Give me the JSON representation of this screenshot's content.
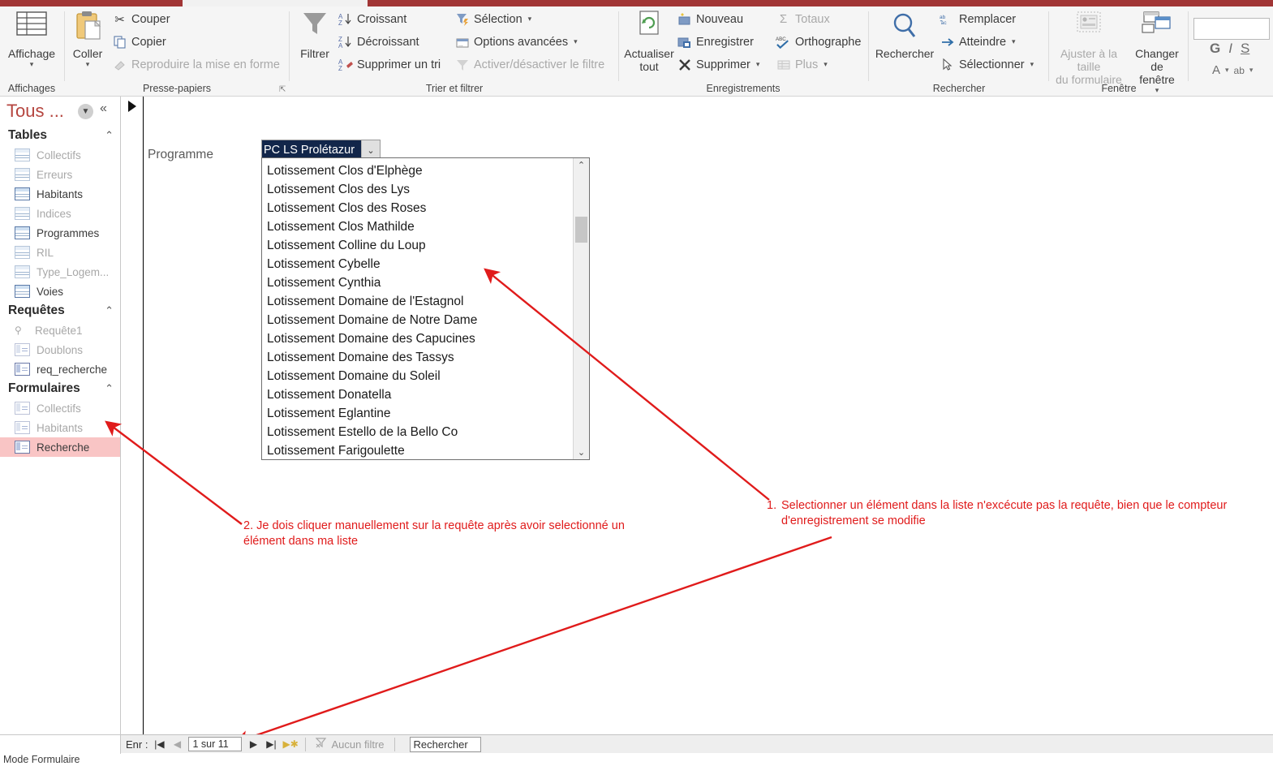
{
  "ribbon": {
    "groups": [
      {
        "name": "Affichages",
        "title": "Affichages"
      },
      {
        "name": "Presse-papiers",
        "title": "Presse-papiers"
      },
      {
        "name": "Trier et filtrer",
        "title": "Trier et filtrer"
      },
      {
        "name": "Enregistrements",
        "title": "Enregistrements"
      },
      {
        "name": "Rechercher",
        "title": "Rechercher"
      },
      {
        "name": "Fenetre",
        "title": "Fenêtre"
      }
    ],
    "affichages": {
      "big_label": "Affichage",
      "icon": "datasheet-view-icon",
      "group_title": "Affichages"
    },
    "presse_papiers": {
      "big_label": "Coller",
      "icon": "clipboard-icon",
      "items": [
        {
          "label": "Couper",
          "icon": "scissors-icon",
          "disabled": false
        },
        {
          "label": "Copier",
          "icon": "copy-icon",
          "disabled": false
        },
        {
          "label": "Reproduire la mise en forme",
          "icon": "format-painter-icon",
          "disabled": true
        }
      ],
      "group_title": "Presse-papiers"
    },
    "trier_filtrer": {
      "big_label": "Filtrer",
      "icon": "funnel-icon",
      "items": [
        {
          "label": "Croissant",
          "icon": "sort-ascending-icon",
          "disabled": false
        },
        {
          "label": "Décroissant",
          "icon": "sort-descending-icon",
          "disabled": false
        },
        {
          "label": "Supprimer un tri",
          "icon": "clear-sort-icon",
          "disabled": false
        },
        {
          "label": "Sélection",
          "icon": "selection-filter-icon",
          "disabled": false,
          "has_dropdown": true
        },
        {
          "label": "Options avancées",
          "icon": "advanced-filter-icon",
          "disabled": false,
          "has_dropdown": true
        },
        {
          "label": "Activer/désactiver le filtre",
          "icon": "toggle-filter-icon",
          "disabled": true
        }
      ],
      "group_title": "Trier et filtrer"
    },
    "enregistrements": {
      "big_label_line1": "Actualiser",
      "big_label_line2": "tout",
      "icon": "refresh-all-icon",
      "items": [
        {
          "label": "Nouveau",
          "icon": "new-record-icon",
          "disabled": false
        },
        {
          "label": "Enregistrer",
          "icon": "save-record-icon",
          "disabled": false
        },
        {
          "label": "Supprimer",
          "icon": "delete-record-icon",
          "disabled": false,
          "has_dropdown": true
        },
        {
          "label": "Totaux",
          "icon": "sum-icon",
          "disabled": true
        },
        {
          "label": "Orthographe",
          "icon": "spelling-icon",
          "disabled": false
        },
        {
          "label": "Plus",
          "icon": "more-icon",
          "disabled": true,
          "has_dropdown": true
        }
      ],
      "group_title": "Enregistrements"
    },
    "rechercher": {
      "big_label": "Rechercher",
      "icon": "magnifier-icon",
      "items": [
        {
          "label": "Remplacer",
          "icon": "replace-icon",
          "disabled": false
        },
        {
          "label": "Atteindre",
          "icon": "goto-arrow-icon",
          "disabled": false,
          "has_dropdown": true
        },
        {
          "label": "Sélectionner",
          "icon": "select-cursor-icon",
          "disabled": false,
          "has_dropdown": true
        }
      ],
      "group_title": "Rechercher"
    },
    "fenetre": {
      "fit_line1": "Ajuster à la taille",
      "fit_line2": "du formulaire",
      "fit_icon": "fit-form-icon",
      "switch_line1": "Changer de",
      "switch_line2": "fenêtre",
      "switch_icon": "switch-windows-icon",
      "group_title": "Fenêtre"
    },
    "font_mini": {
      "font_name_value": "",
      "bold": "G",
      "italic": "I",
      "underline": "S",
      "font_color": "A",
      "highlight": "ab"
    }
  },
  "navpane": {
    "title": "Tous ...",
    "filter_icon": "filter-dropdown-icon",
    "collapse_icon": "collapse-left-icon",
    "groups": [
      {
        "name": "Tables",
        "label": "Tables",
        "items": [
          {
            "label": "Collectifs",
            "icon": "table-icon",
            "dim": true,
            "selected": false
          },
          {
            "label": "Erreurs",
            "icon": "table-icon",
            "dim": true,
            "selected": false
          },
          {
            "label": "Habitants",
            "icon": "table-icon",
            "dim": false,
            "selected": false
          },
          {
            "label": "Indices",
            "icon": "table-icon",
            "dim": true,
            "selected": false
          },
          {
            "label": "Programmes",
            "icon": "table-icon",
            "dim": false,
            "selected": false
          },
          {
            "label": "RIL",
            "icon": "table-icon",
            "dim": true,
            "selected": false
          },
          {
            "label": "Type_Logem...",
            "icon": "table-icon",
            "dim": true,
            "selected": false
          },
          {
            "label": "Voies",
            "icon": "table-icon",
            "dim": false,
            "selected": false
          }
        ]
      },
      {
        "name": "Requetes",
        "label": "Requêtes",
        "items": [
          {
            "label": "Requête1",
            "icon": "query-icon",
            "dim": true,
            "selected": false
          },
          {
            "label": "Doublons",
            "icon": "query-form-icon",
            "dim": true,
            "selected": false
          },
          {
            "label": "req_recherche",
            "icon": "query-form-icon",
            "dim": false,
            "selected": false
          }
        ]
      },
      {
        "name": "Formulaires",
        "label": "Formulaires",
        "items": [
          {
            "label": "Collectifs",
            "icon": "form-icon",
            "dim": true,
            "selected": false
          },
          {
            "label": "Habitants",
            "icon": "form-icon",
            "dim": true,
            "selected": false
          },
          {
            "label": "Recherche",
            "icon": "form-icon",
            "dim": false,
            "selected": true
          }
        ]
      }
    ]
  },
  "form": {
    "programme_label": "Programme",
    "combo": {
      "value": "PC LS Prolétazur",
      "dropdown_icon": "chevron-down-icon",
      "options": [
        "Lotissement Clos d'Elphège",
        "Lotissement Clos des Lys",
        "Lotissement Clos des Roses",
        "Lotissement Clos Mathilde",
        "Lotissement Colline du Loup",
        "Lotissement Cybelle",
        "Lotissement Cynthia",
        "Lotissement Domaine de l'Estagnol",
        "Lotissement Domaine de Notre Dame",
        "Lotissement Domaine des Capucines",
        "Lotissement Domaine des Tassys",
        "Lotissement Domaine du Soleil",
        "Lotissement Donatella",
        "Lotissement Eglantine",
        "Lotissement Estello de la Bello Co",
        "Lotissement Farigoulette"
      ],
      "scroll_up_icon": "chevron-up-icon",
      "scroll_down_icon": "chevron-down-icon"
    }
  },
  "annotations": {
    "color": "#e01b1b",
    "note1_number": "1.",
    "note1_text": "Selectionner un élément dans la liste n'excécute pas la requête, bien que le compteur d'enregistrement se modifie",
    "note2_text": "2. Je dois cliquer manuellement sur la requête après avoir selectionné un élément dans ma liste"
  },
  "recordnav": {
    "label": "Enr :",
    "first_icon": "go-first-icon",
    "prev_icon": "go-previous-icon",
    "position": "1 sur 11",
    "next_icon": "go-next-icon",
    "last_icon": "go-last-icon",
    "new_icon": "new-record-icon",
    "filter_icon": "no-filter-icon",
    "filter_state": "Aucun filtre",
    "search_value": "Rechercher"
  },
  "statusbar": {
    "mode": "Mode Formulaire"
  }
}
